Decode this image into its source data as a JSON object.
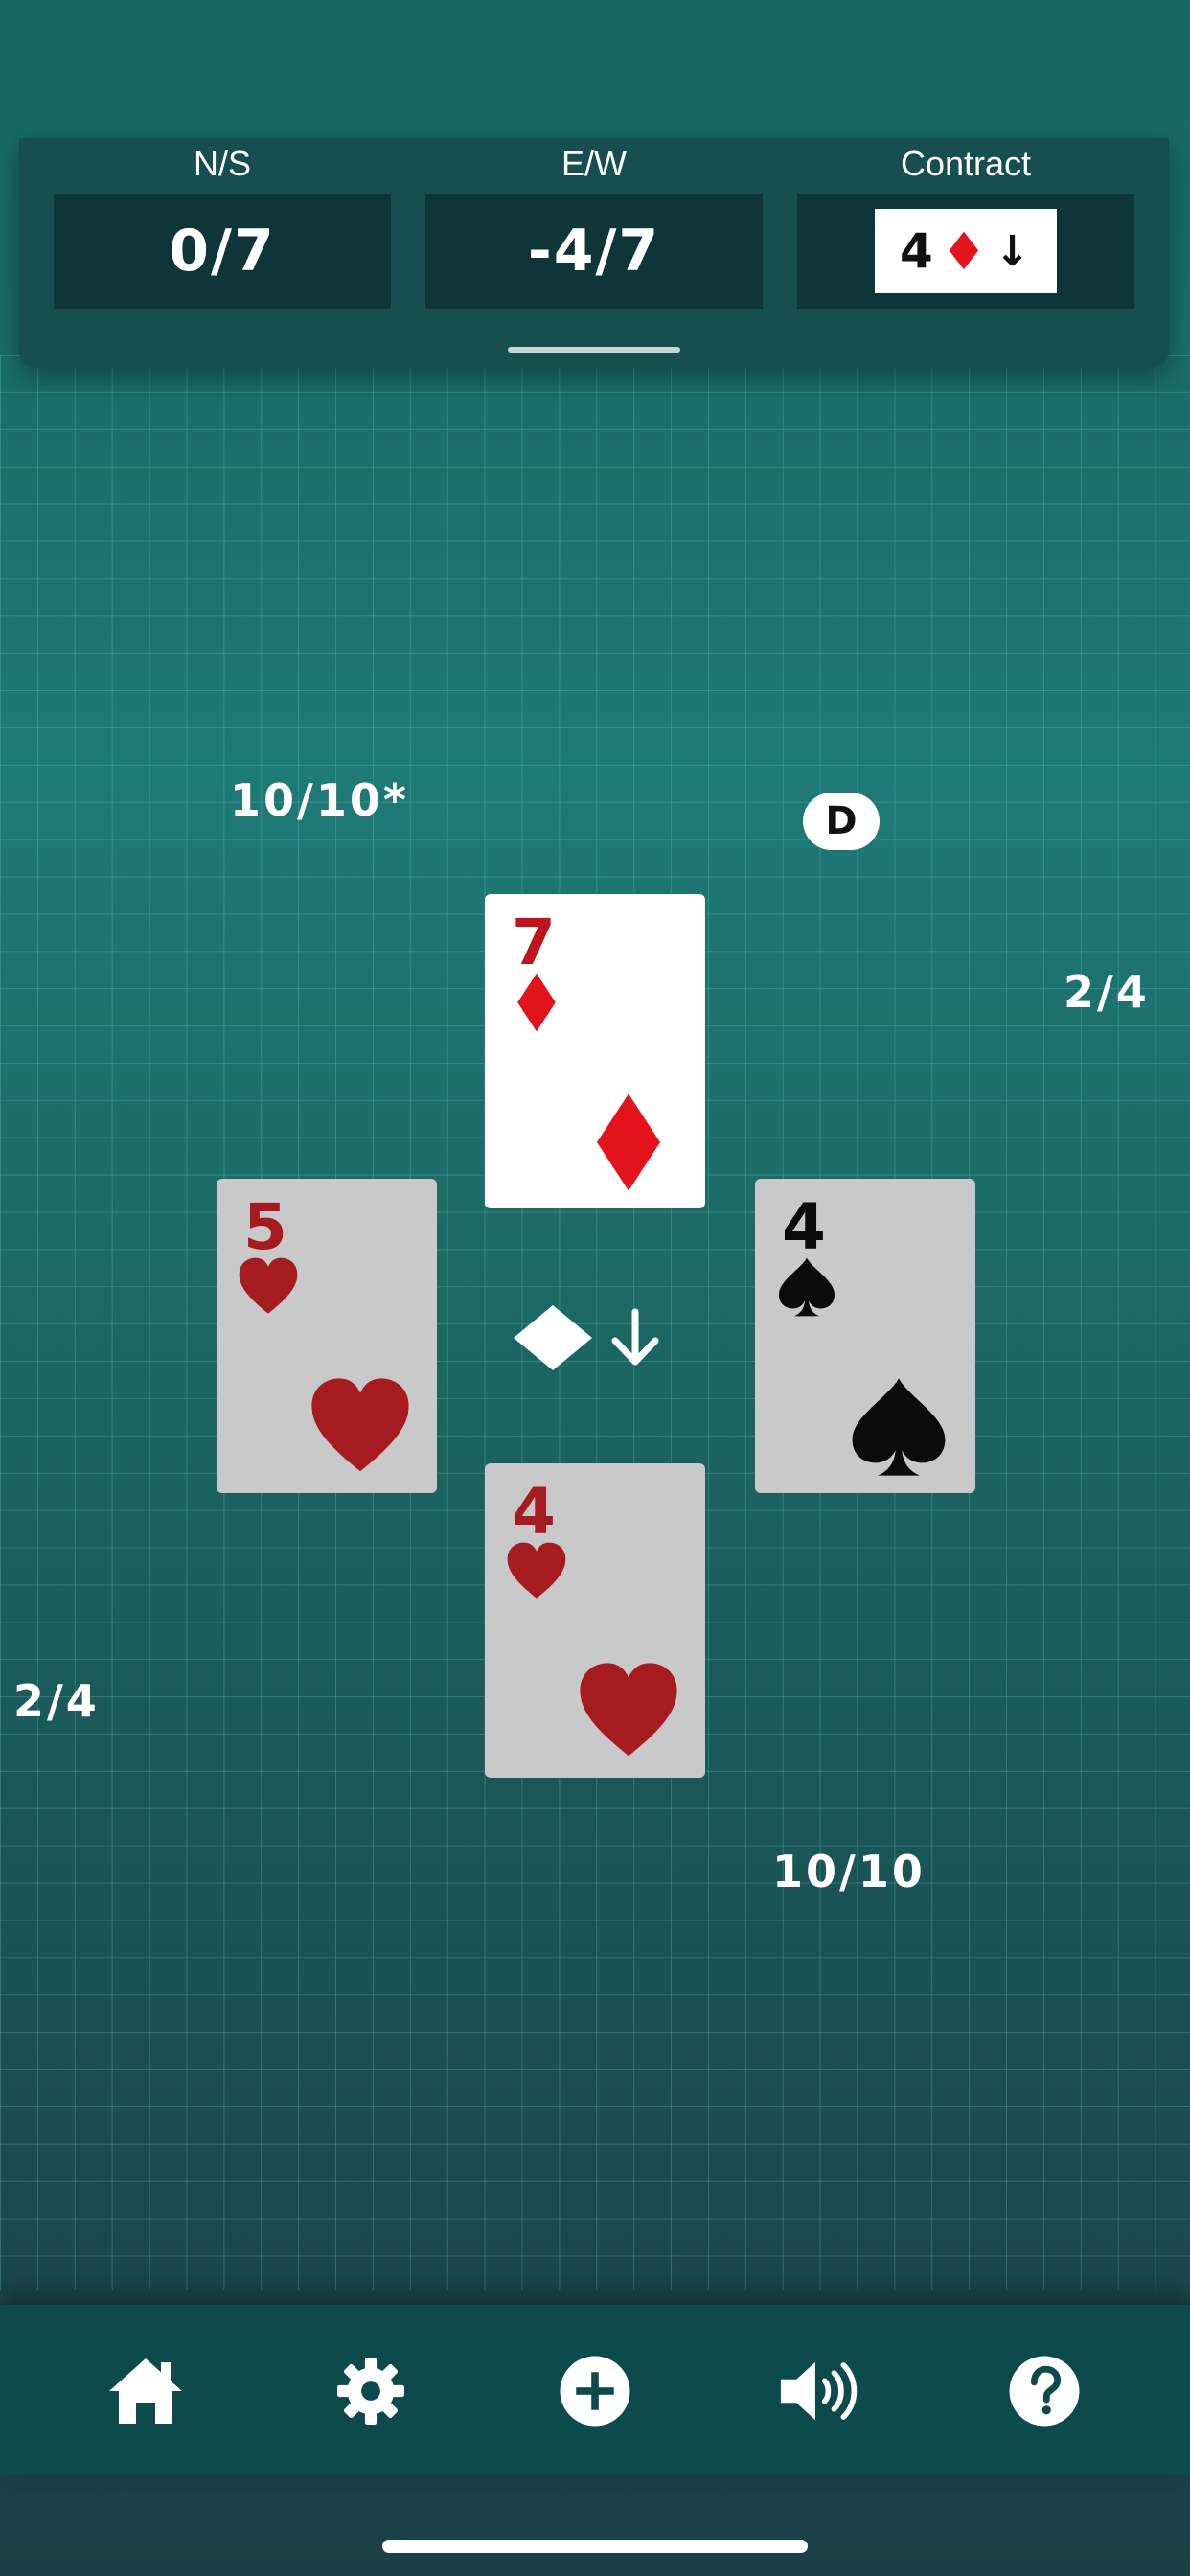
{
  "scoreboard": {
    "ns": {
      "label": "N/S",
      "value": "0/7"
    },
    "ew": {
      "label": "E/W",
      "value": "-4/7"
    },
    "contract": {
      "label": "Contract",
      "level": "4",
      "suit": "♦",
      "arrow": "↓"
    }
  },
  "players": {
    "north_west": {
      "tricks": "10/10*"
    },
    "east": {
      "tricks": "2/4"
    },
    "west": {
      "tricks": "2/4"
    },
    "south_east": {
      "tricks": "10/10"
    },
    "dealer": {
      "badge": "D"
    }
  },
  "trick": {
    "north": {
      "rank": "7",
      "suit": "diamond",
      "color": "#e3121b"
    },
    "west": {
      "rank": "5",
      "suit": "heart",
      "color": "#a61b1f"
    },
    "east": {
      "rank": "4",
      "suit": "spade",
      "color": "#0b0b0b"
    },
    "south": {
      "rank": "4",
      "suit": "heart",
      "color": "#a61b1f"
    },
    "indicator": {
      "suit": "diamond-icon",
      "arrow": "↓"
    }
  },
  "nav": [
    {
      "icon": "home-icon"
    },
    {
      "icon": "gear-icon"
    },
    {
      "icon": "plus-circle-icon"
    },
    {
      "icon": "speaker-icon"
    },
    {
      "icon": "help-icon"
    }
  ],
  "colors": {
    "panel": "#174e4f",
    "score_box": "#0e3638",
    "bottom_bar": "#0d4a4b",
    "card_face": "#c9c9c9",
    "lead_card_face": "#ffffff"
  }
}
